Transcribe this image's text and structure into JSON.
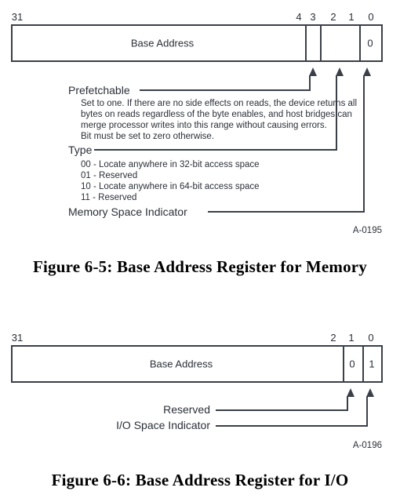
{
  "figures": [
    {
      "id": "memory",
      "register": {
        "name": "Base Address",
        "bit_labels": [
          "31",
          "4",
          "3",
          "2",
          "1",
          "0"
        ],
        "cells": [
          {
            "name": "base-address",
            "label": "Base Address",
            "value": ""
          },
          {
            "name": "prefetchable-bit",
            "label": "",
            "value": ""
          },
          {
            "name": "type-bits",
            "label": "",
            "value": ""
          },
          {
            "name": "memory-space-indicator-bit",
            "label": "",
            "value": "0"
          }
        ]
      },
      "callouts": [
        {
          "name": "prefetchable",
          "title": "Prefetchable",
          "description": [
            "Set to one. If there are no side effects on reads, the device returns all",
            "bytes on reads regardless of the byte enables, and host bridges can",
            "merge processor writes into this range without causing errors.",
            "Bit must be set to zero otherwise."
          ],
          "options": []
        },
        {
          "name": "type",
          "title": "Type",
          "description": [],
          "options": [
            "00 - Locate anywhere in 32-bit access space",
            "01 - Reserved",
            "10 - Locate anywhere in 64-bit access space",
            "11 - Reserved"
          ]
        },
        {
          "name": "memory-space-indicator",
          "title": "Memory Space Indicator",
          "description": [],
          "options": []
        }
      ],
      "ref_tag": "A-0195",
      "caption": "Figure 6-5:  Base Address Register for Memory"
    },
    {
      "id": "io",
      "register": {
        "name": "Base Address",
        "bit_labels": [
          "31",
          "2",
          "1",
          "0"
        ],
        "cells": [
          {
            "name": "base-address",
            "label": "Base Address",
            "value": ""
          },
          {
            "name": "reserved-bit",
            "label": "",
            "value": "0"
          },
          {
            "name": "io-space-indicator-bit",
            "label": "",
            "value": "1"
          }
        ]
      },
      "callouts": [
        {
          "name": "reserved",
          "title": "Reserved",
          "description": [],
          "options": []
        },
        {
          "name": "io-space-indicator",
          "title": "I/O Space Indicator",
          "description": [],
          "options": []
        }
      ],
      "ref_tag": "A-0196",
      "caption": "Figure 6-6:  Base Address Register for I/O"
    }
  ],
  "colors": {
    "ink": "#2b2f38",
    "rule": "#3a3f48",
    "page": "#ffffff"
  }
}
